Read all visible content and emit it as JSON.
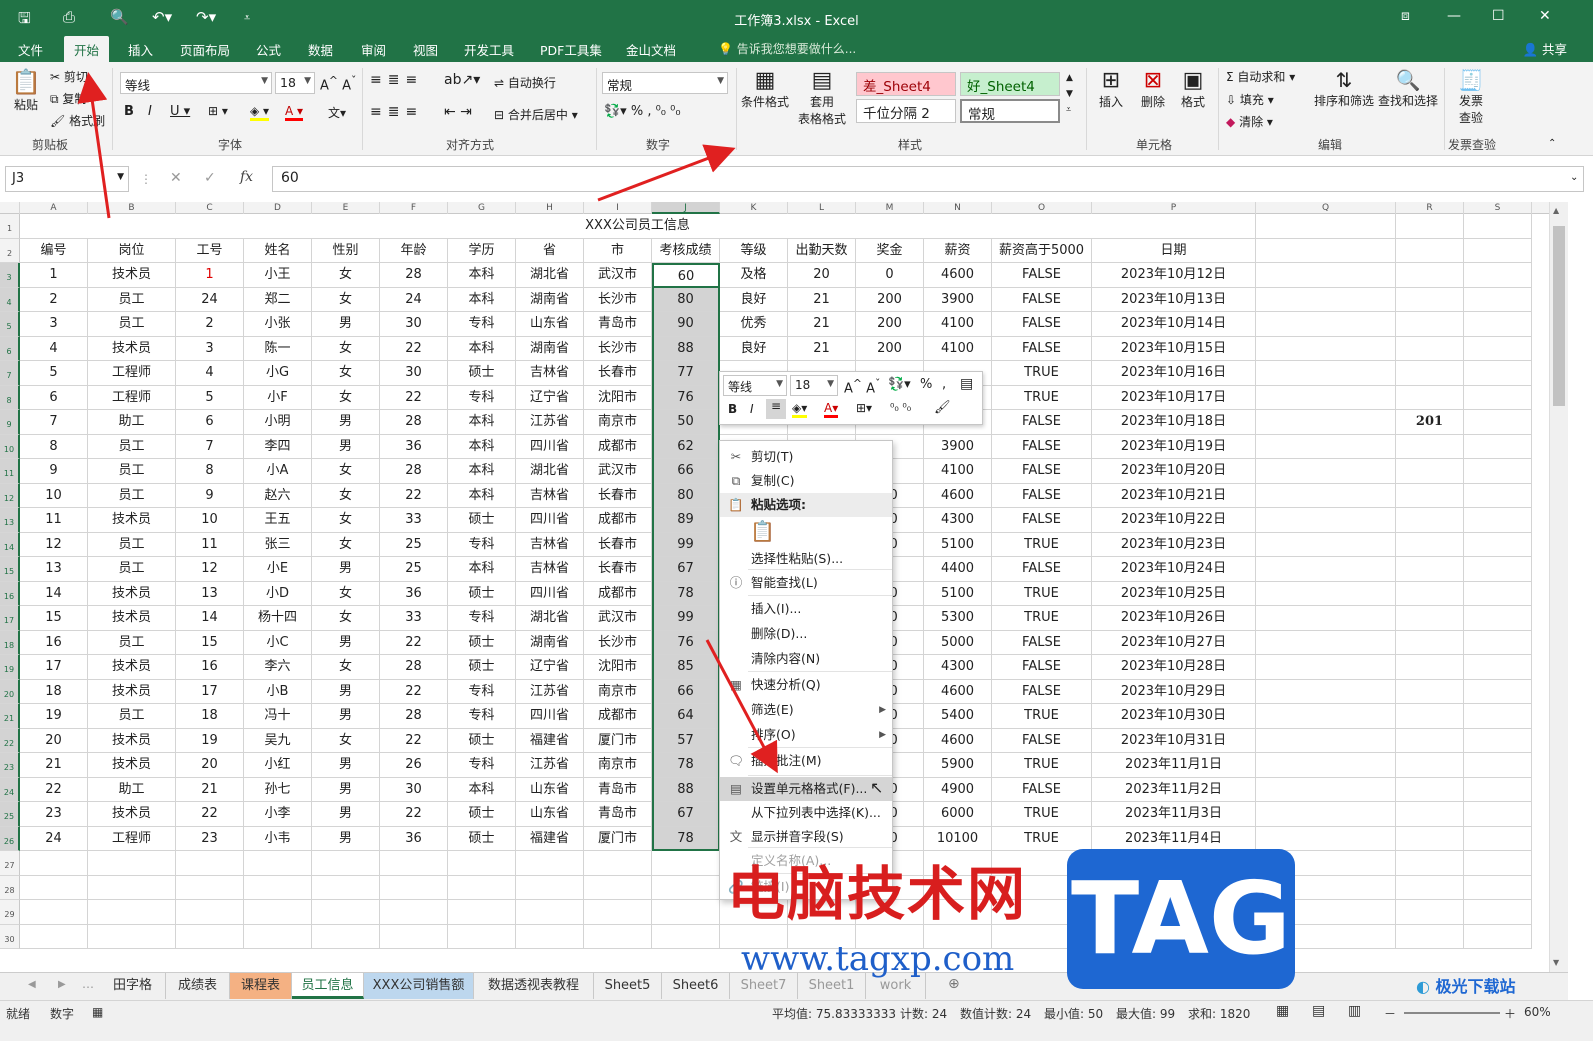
{
  "window": {
    "title": "工作簿3.xlsx - Excel",
    "share": "共享",
    "tellme": "告诉我您想要做什么..."
  },
  "tabs": [
    "文件",
    "开始",
    "插入",
    "页面布局",
    "公式",
    "数据",
    "审阅",
    "视图",
    "开发工具",
    "PDF工具集",
    "金山文档"
  ],
  "ribbon": {
    "clipboard": {
      "paste": "粘贴",
      "cut": "剪切",
      "copy": "复制",
      "format_painter": "格式刷",
      "label": "剪贴板"
    },
    "font": {
      "name": "等线",
      "size": "18",
      "label": "字体"
    },
    "align": {
      "wrap": "自动换行",
      "merge": "合并后居中",
      "label": "对齐方式"
    },
    "number": {
      "format": "常规",
      "label": "数字"
    },
    "styles": {
      "cond": "条件格式",
      "table1": "套用",
      "table2": "表格格式",
      "bad": "差_Sheet4",
      "good": "好_Sheet4",
      "thousands": "千位分隔 2",
      "normal": "常规",
      "label": "样式"
    },
    "cells": {
      "insert": "插入",
      "delete": "删除",
      "format": "格式",
      "label": "单元格"
    },
    "edit": {
      "autosum": "自动求和",
      "fill": "填充",
      "clear": "清除",
      "sort": "排序和筛选",
      "find": "查找和选择",
      "label": "编辑"
    },
    "invoice": {
      "l1": "发票",
      "l2": "查验",
      "label": "发票查验"
    }
  },
  "formula": {
    "name_box": "J3",
    "value": "60",
    "fx": "fx"
  },
  "columns": [
    "A",
    "B",
    "C",
    "D",
    "E",
    "F",
    "G",
    "H",
    "I",
    "J",
    "K",
    "L",
    "M",
    "N",
    "O",
    "P",
    "Q",
    "R",
    "S"
  ],
  "sheet": {
    "title": "XXX公司员工信息",
    "headers": [
      "编号",
      "岗位",
      "工号",
      "姓名",
      "性别",
      "年龄",
      "学历",
      "省",
      "市",
      "考核成绩",
      "等级",
      "出勤天数",
      "奖金",
      "薪资",
      "薪资高于5000",
      "日期"
    ],
    "rows": [
      [
        "1",
        "技术员",
        "1",
        "小王",
        "女",
        "28",
        "本科",
        "湖北省",
        "武汉市",
        "60",
        "及格",
        "20",
        "0",
        "4600",
        "FALSE",
        "2023年10月12日"
      ],
      [
        "2",
        "员工",
        "24",
        "郑二",
        "女",
        "24",
        "本科",
        "湖南省",
        "长沙市",
        "80",
        "良好",
        "21",
        "200",
        "3900",
        "FALSE",
        "2023年10月13日"
      ],
      [
        "3",
        "员工",
        "2",
        "小张",
        "男",
        "30",
        "专科",
        "山东省",
        "青岛市",
        "90",
        "优秀",
        "21",
        "200",
        "4100",
        "FALSE",
        "2023年10月14日"
      ],
      [
        "4",
        "技术员",
        "3",
        "陈一",
        "女",
        "22",
        "本科",
        "湖南省",
        "长沙市",
        "88",
        "良好",
        "21",
        "200",
        "4100",
        "FALSE",
        "2023年10月15日"
      ],
      [
        "5",
        "工程师",
        "4",
        "小G",
        "女",
        "30",
        "硕士",
        "吉林省",
        "长春市",
        "77",
        "",
        "",
        "",
        "",
        "TRUE",
        "2023年10月16日"
      ],
      [
        "6",
        "工程师",
        "5",
        "小F",
        "女",
        "22",
        "专科",
        "辽宁省",
        "沈阳市",
        "76",
        "",
        "",
        "",
        "",
        "TRUE",
        "2023年10月17日"
      ],
      [
        "7",
        "助工",
        "6",
        "小明",
        "男",
        "28",
        "本科",
        "江苏省",
        "南京市",
        "50",
        "",
        "",
        "",
        "",
        "FALSE",
        "2023年10月18日"
      ],
      [
        "8",
        "员工",
        "7",
        "李四",
        "男",
        "36",
        "本科",
        "四川省",
        "成都市",
        "62",
        "",
        "",
        "0",
        "3900",
        "FALSE",
        "2023年10月19日"
      ],
      [
        "9",
        "员工",
        "8",
        "小A",
        "女",
        "28",
        "本科",
        "湖北省",
        "武汉市",
        "66",
        "",
        "",
        "0",
        "4100",
        "FALSE",
        "2023年10月20日"
      ],
      [
        "10",
        "员工",
        "9",
        "赵六",
        "女",
        "22",
        "本科",
        "吉林省",
        "长春市",
        "80",
        "",
        "",
        "00",
        "4600",
        "FALSE",
        "2023年10月21日"
      ],
      [
        "11",
        "技术员",
        "10",
        "王五",
        "女",
        "33",
        "硕士",
        "四川省",
        "成都市",
        "89",
        "",
        "",
        "00",
        "4300",
        "FALSE",
        "2023年10月22日"
      ],
      [
        "12",
        "员工",
        "11",
        "张三",
        "女",
        "25",
        "专科",
        "吉林省",
        "长春市",
        "99",
        "",
        "",
        "00",
        "5100",
        "TRUE",
        "2023年10月23日"
      ],
      [
        "13",
        "员工",
        "12",
        "小E",
        "男",
        "25",
        "本科",
        "吉林省",
        "长春市",
        "67",
        "",
        "",
        "0",
        "4400",
        "FALSE",
        "2023年10月24日"
      ],
      [
        "14",
        "技术员",
        "13",
        "小D",
        "女",
        "36",
        "硕士",
        "四川省",
        "成都市",
        "78",
        "",
        "",
        "00",
        "5100",
        "TRUE",
        "2023年10月25日"
      ],
      [
        "15",
        "技术员",
        "14",
        "杨十四",
        "女",
        "33",
        "专科",
        "湖北省",
        "武汉市",
        "99",
        "",
        "",
        "00",
        "5300",
        "TRUE",
        "2023年10月26日"
      ],
      [
        "16",
        "员工",
        "15",
        "小C",
        "男",
        "22",
        "硕士",
        "湖南省",
        "长沙市",
        "76",
        "",
        "",
        "00",
        "5000",
        "FALSE",
        "2023年10月27日"
      ],
      [
        "17",
        "技术员",
        "16",
        "李六",
        "女",
        "28",
        "硕士",
        "辽宁省",
        "沈阳市",
        "85",
        "",
        "",
        "00",
        "4300",
        "FALSE",
        "2023年10月28日"
      ],
      [
        "18",
        "技术员",
        "17",
        "小B",
        "男",
        "22",
        "专科",
        "江苏省",
        "南京市",
        "66",
        "",
        "",
        "00",
        "4600",
        "FALSE",
        "2023年10月29日"
      ],
      [
        "19",
        "员工",
        "18",
        "冯十",
        "男",
        "28",
        "专科",
        "四川省",
        "成都市",
        "64",
        "",
        "",
        "00",
        "5400",
        "TRUE",
        "2023年10月30日"
      ],
      [
        "20",
        "技术员",
        "19",
        "吴九",
        "女",
        "22",
        "硕士",
        "福建省",
        "厦门市",
        "57",
        "",
        "",
        "00",
        "4600",
        "FALSE",
        "2023年10月31日"
      ],
      [
        "21",
        "技术员",
        "20",
        "小红",
        "男",
        "26",
        "专科",
        "江苏省",
        "南京市",
        "78",
        "",
        "",
        "0",
        "5900",
        "TRUE",
        "2023年11月1日"
      ],
      [
        "22",
        "助工",
        "21",
        "孙七",
        "男",
        "30",
        "本科",
        "山东省",
        "青岛市",
        "88",
        "",
        "",
        "00",
        "4900",
        "FALSE",
        "2023年11月2日"
      ],
      [
        "23",
        "技术员",
        "22",
        "小李",
        "男",
        "22",
        "硕士",
        "山东省",
        "青岛市",
        "67",
        "",
        "",
        "00",
        "6000",
        "TRUE",
        "2023年11月3日"
      ],
      [
        "24",
        "工程师",
        "23",
        "小韦",
        "男",
        "36",
        "硕士",
        "福建省",
        "厦门市",
        "78",
        "",
        "",
        "00",
        "10100",
        "TRUE",
        "2023年11月4日"
      ]
    ],
    "r_col_value": "201",
    "row_numbers": [
      "1",
      "2",
      "3",
      "4",
      "5",
      "6",
      "7",
      "8",
      "9",
      "10",
      "11",
      "12",
      "13",
      "14",
      "15",
      "16",
      "17",
      "18",
      "19",
      "20",
      "21",
      "22",
      "23",
      "24",
      "25",
      "26",
      "27",
      "28",
      "29",
      "30"
    ]
  },
  "mini_toolbar": {
    "font": "等线",
    "size": "18"
  },
  "context_menu": [
    {
      "icon": "scissors-icon",
      "glyph": "✂",
      "label": "剪切(T)"
    },
    {
      "icon": "copy-icon",
      "glyph": "⧉",
      "label": "复制(C)"
    },
    {
      "icon": "paste-icon",
      "glyph": "📋",
      "label": "粘贴选项:"
    },
    {
      "icon": "",
      "glyph": "",
      "label": "选择性粘贴(S)..."
    },
    {
      "icon": "smart-lookup-icon",
      "glyph": "ⓘ",
      "label": "智能查找(L)"
    },
    {
      "icon": "",
      "glyph": "",
      "label": "插入(I)..."
    },
    {
      "icon": "",
      "glyph": "",
      "label": "删除(D)..."
    },
    {
      "icon": "",
      "glyph": "",
      "label": "清除内容(N)"
    },
    {
      "icon": "quick-analysis-icon",
      "glyph": "▦",
      "label": "快速分析(Q)"
    },
    {
      "icon": "",
      "glyph": "",
      "label": "筛选(E)"
    },
    {
      "icon": "",
      "glyph": "",
      "label": "排序(O)"
    },
    {
      "icon": "comment-icon",
      "glyph": "🗨",
      "label": "插入批注(M)"
    },
    {
      "icon": "format-cells-icon",
      "glyph": "▤",
      "label": "设置单元格格式(F)..."
    },
    {
      "icon": "",
      "glyph": "",
      "label": "从下拉列表中选择(K)..."
    },
    {
      "icon": "pinyin-icon",
      "glyph": "文",
      "label": "显示拼音字段(S)"
    },
    {
      "icon": "",
      "glyph": "",
      "label": "定义名称(A)..."
    },
    {
      "icon": "link-icon",
      "glyph": "🔗",
      "label": "链接(I)"
    }
  ],
  "sheet_tabs": [
    "田字格",
    "成绩表",
    "课程表",
    "员工信息",
    "XXX公司销售额",
    "数据透视表教程",
    "Sheet5",
    "Sheet6",
    "Sheet7",
    "Sheet1",
    "work"
  ],
  "status": {
    "ready": "就绪",
    "num": "数字",
    "avg": "平均值: 75.83333333",
    "count": "计数: 24",
    "numcount": "数值计数: 24",
    "min": "最小值: 50",
    "max": "最大值: 99",
    "sum": "求和: 1820",
    "zoom": "60%"
  },
  "watermark": {
    "text": "电脑技术网",
    "url": "www.tagxp.com",
    "tag": "TAG",
    "site": "极光下载站"
  },
  "colors": {
    "excel_green": "#217346",
    "selection": "#d3d3d3",
    "bad_style": "#ffc7ce",
    "good_style": "#c6efce",
    "tab_orange": "#f4b183",
    "tab_blue": "#bdd7ee",
    "arrow_red": "#e02020"
  }
}
